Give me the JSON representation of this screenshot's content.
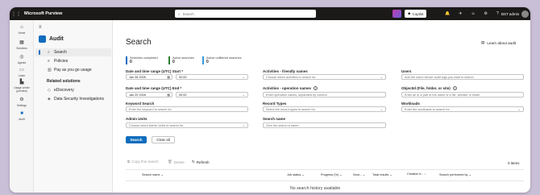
{
  "app": {
    "brand": "Microsoft Purview",
    "search_placeholder": "Search",
    "copilot_label": "Copilot",
    "user_label": "BST admin"
  },
  "rail": [
    {
      "icon": "home-icon",
      "glyph": "⌂",
      "label": "Home"
    },
    {
      "icon": "solutions-icon",
      "glyph": "▦",
      "label": "Solutions"
    },
    {
      "icon": "agents-icon",
      "glyph": "◎",
      "label": "Agents"
    },
    {
      "icon": "learn-icon",
      "glyph": "▭",
      "label": "Learn"
    },
    {
      "icon": "usage-center-icon",
      "glyph": "▙",
      "label": "Usage center (preview)"
    },
    {
      "icon": "settings-icon",
      "glyph": "⚙",
      "label": "Settings"
    },
    {
      "icon": "audit-icon",
      "glyph": "■",
      "label": "Audit"
    }
  ],
  "nav": {
    "solution_name": "Audit",
    "items": [
      {
        "label": "Search",
        "icon": "search-icon",
        "glyph": "⌕",
        "active": true
      },
      {
        "label": "Policies",
        "icon": "policies-icon",
        "glyph": "≡",
        "active": false
      },
      {
        "label": "Pay as you go usage",
        "icon": "usage-icon",
        "glyph": "▥",
        "active": false
      }
    ],
    "related_heading": "Related solutions",
    "related": [
      {
        "label": "eDiscovery",
        "icon": "ediscovery-icon",
        "glyph": "◇"
      },
      {
        "label": "Data Security Investigations",
        "icon": "investigations-icon",
        "glyph": "◈"
      }
    ]
  },
  "page": {
    "title": "Search",
    "learn_link": "Learn about audit",
    "counters": [
      {
        "label": "Searches completed",
        "value": "0"
      },
      {
        "label": "Active searches",
        "value": "0"
      },
      {
        "label": "Active unfiltered searches",
        "value": "0"
      }
    ]
  },
  "form": {
    "start_label": "Date and time range (UTC) Start *",
    "start_date": "Jan 28 2026",
    "start_time": "00:00",
    "end_label": "Date and time range (UTC) End *",
    "end_date": "Jan 29 2026",
    "end_time": "00:00",
    "keyword_label": "Keyword Search",
    "keyword_placeholder": "Enter the keyword to search for",
    "admin_units_label": "Admin Units",
    "admin_units_placeholder": "Choose which Admin Units to search for",
    "activities_friendly_label": "Activities - friendly names",
    "activities_friendly_placeholder": "Choose which activities to search for",
    "activities_ops_label": "Activities - operation names",
    "activities_ops_placeholder": "Enter operation values, separated by comma",
    "record_types_label": "Record Types",
    "record_types_placeholder": "Select the record types to search for",
    "search_name_label": "Search name",
    "search_name_placeholder": "Give the search a name",
    "users_label": "Users",
    "users_placeholder": "Add the users whose audit logs you want to search",
    "object_label": "ObjectId (File, folder, or site)",
    "object_placeholder": "Enter all or a part of the name of a file, website or folder",
    "workloads_label": "Workloads",
    "workloads_placeholder": "Enter the workloads to search for",
    "search_button": "Search",
    "clear_button": "Clear all"
  },
  "results": {
    "copy_label": "Copy this search",
    "delete_label": "Delete",
    "refresh_label": "Refresh",
    "items_count": "0 items",
    "columns": [
      "Search name",
      "Job status",
      "Progress (%)",
      "Sear...",
      "Total results",
      "Creation ti... ↓",
      "Search performed by"
    ],
    "empty_message": "No search history available"
  }
}
